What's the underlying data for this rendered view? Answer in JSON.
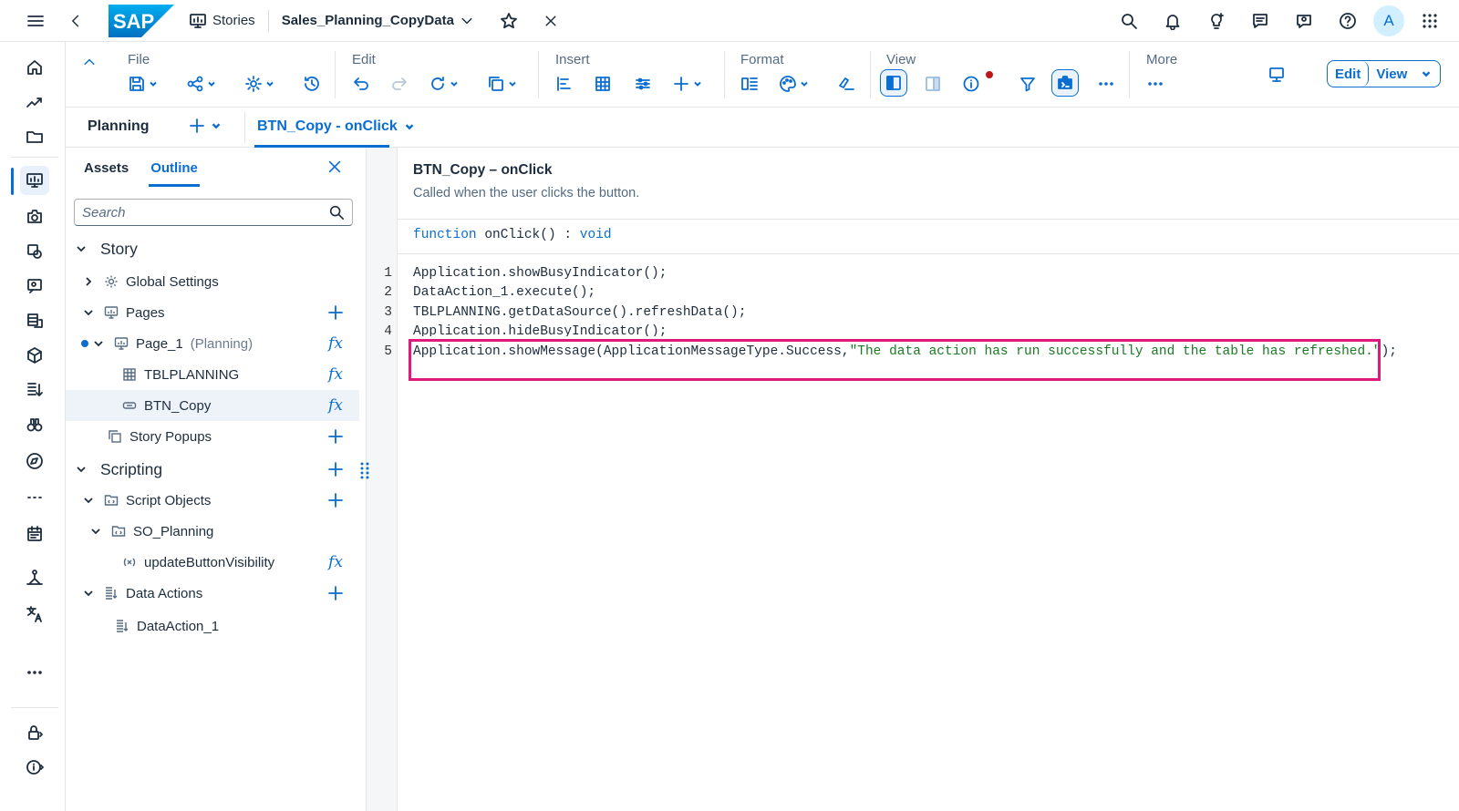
{
  "shell": {
    "logo_text": "SAP",
    "breadcrumb": "Stories",
    "story_title": "Sales_Planning_CopyData",
    "avatar_letter": "A"
  },
  "toolbar": {
    "groups": {
      "file": "File",
      "edit": "Edit",
      "insert": "Insert",
      "format": "Format",
      "view": "View",
      "more": "More"
    },
    "edit_label": "Edit",
    "view_label": "View"
  },
  "tabs": {
    "planning": "Planning",
    "active": "BTN_Copy - onClick"
  },
  "outline": {
    "tab_assets": "Assets",
    "tab_outline": "Outline",
    "search_placeholder": "Search",
    "tree": {
      "story": "Story",
      "global_settings": "Global Settings",
      "pages": "Pages",
      "page_1": "Page_1",
      "page_1_type": "(Planning)",
      "tblplanning": "TBLPLANNING",
      "btn_copy": "BTN_Copy",
      "story_popups": "Story Popups",
      "scripting": "Scripting",
      "script_objects": "Script Objects",
      "so_planning": "SO_Planning",
      "update_button_visibility": "updateButtonVisibility",
      "data_actions": "Data Actions",
      "data_action_1": "DataAction_1"
    }
  },
  "editor": {
    "title": "BTN_Copy – onClick",
    "description": "Called when the user clicks the button.",
    "sig_keyword": "function",
    "sig_name": " onClick() : ",
    "sig_return": "void",
    "line_numbers": [
      "1",
      "2",
      "3",
      "4",
      "5"
    ],
    "lines": [
      "Application.showBusyIndicator();",
      "DataAction_1.execute();",
      "TBLPLANNING.getDataSource().refreshData();",
      "Application.hideBusyIndicator();"
    ],
    "line5_code": "Application.showMessage(ApplicationMessageType.Success,",
    "line5_string": "\"The data action has run successfully and the table has refreshed.\"",
    "line5_end": ");"
  },
  "colors": {
    "accent": "#0a6ed1",
    "highlight": "#e0197d",
    "string": "#1a7a23"
  }
}
